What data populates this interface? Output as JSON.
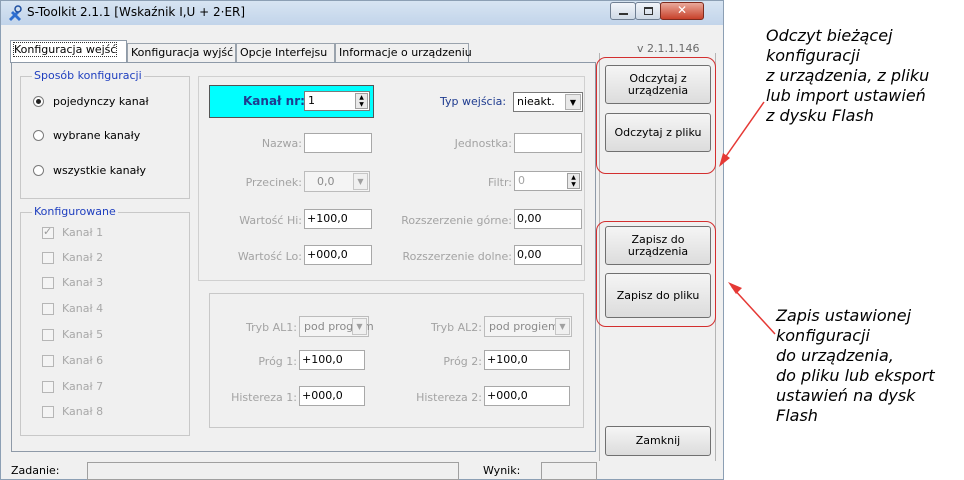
{
  "window": {
    "title": "S-Toolkit  2.1.1  [Wskaźnik I,U + 2·ER]",
    "version": "v 2.1.1.146"
  },
  "tabs": [
    {
      "label": "Konfiguracja wejść",
      "active": true
    },
    {
      "label": "Konfiguracja wyjść",
      "active": false
    },
    {
      "label": "Opcje Interfejsu",
      "active": false
    },
    {
      "label": "Informacje o urządzeniu",
      "active": false
    }
  ],
  "config_mode": {
    "title": "Sposób konfiguracji",
    "options": [
      {
        "label": "pojedynczy kanał",
        "selected": true
      },
      {
        "label": "wybrane kanały",
        "selected": false
      },
      {
        "label": "wszystkie kanały",
        "selected": false
      }
    ]
  },
  "configured": {
    "title": "Konfigurowane",
    "channels": [
      {
        "label": "Kanał 1",
        "checked": true
      },
      {
        "label": "Kanał 2",
        "checked": false
      },
      {
        "label": "Kanał 3",
        "checked": false
      },
      {
        "label": "Kanał 4",
        "checked": false
      },
      {
        "label": "Kanał 5",
        "checked": false
      },
      {
        "label": "Kanał 6",
        "checked": false
      },
      {
        "label": "Kanał 7",
        "checked": false
      },
      {
        "label": "Kanał 8",
        "checked": false
      }
    ]
  },
  "channel": {
    "label": "Kanał nr:",
    "value": "1",
    "highlight_color": "#00ffff"
  },
  "input_type": {
    "label": "Typ wejścia:",
    "value": "nieakt."
  },
  "fields": {
    "name_label": "Nazwa:",
    "name_value": "",
    "unit_label": "Jednostka:",
    "unit_value": "",
    "decimal_label": "Przecinek:",
    "decimal_value": "0,0",
    "filter_label": "Filtr:",
    "filter_value": "0",
    "hi_label": "Wartość Hi:",
    "hi_value": "+100,0",
    "ext_top_label": "Rozszerzenie górne:",
    "ext_top_value": "0,00",
    "lo_label": "Wartość Lo:",
    "lo_value": "+000,0",
    "ext_bottom_label": "Rozszerzenie dolne:",
    "ext_bottom_value": "0,00"
  },
  "alarms": {
    "al1_mode_label": "Tryb AL1:",
    "al1_mode_value": "pod progiem",
    "al2_mode_label": "Tryb AL2:",
    "al2_mode_value": "pod progiem",
    "threshold1_label": "Próg 1:",
    "threshold1_value": "+100,0",
    "threshold2_label": "Próg 2:",
    "threshold2_value": "+100,0",
    "hyst1_label": "Histereza 1:",
    "hyst1_value": "+000,0",
    "hyst2_label": "Histereza 2:",
    "hyst2_value": "+000,0"
  },
  "buttons": {
    "read_device": "Odczytaj z urządzenia",
    "read_file": "Odczytaj z pliku",
    "write_device": "Zapisz do urządzenia",
    "write_file": "Zapisz do pliku",
    "close": "Zamknij"
  },
  "statusbar": {
    "task_label": "Zadanie:",
    "result_label": "Wynik:"
  },
  "annotations": {
    "read": [
      "Odczyt bieżącej",
      "konfiguracji",
      "z urządzenia, z pliku",
      "lub import ustawień",
      "z dysku Flash"
    ],
    "write": [
      "Zapis ustawionej",
      "konfiguracji",
      "do urządzenia,",
      "do pliku lub eksport",
      "ustawień na dysk",
      "Flash"
    ]
  },
  "colors": {
    "group_title": "#1f3fbf",
    "annotation_box": "#d32f2f",
    "arrow": "#e53935"
  }
}
